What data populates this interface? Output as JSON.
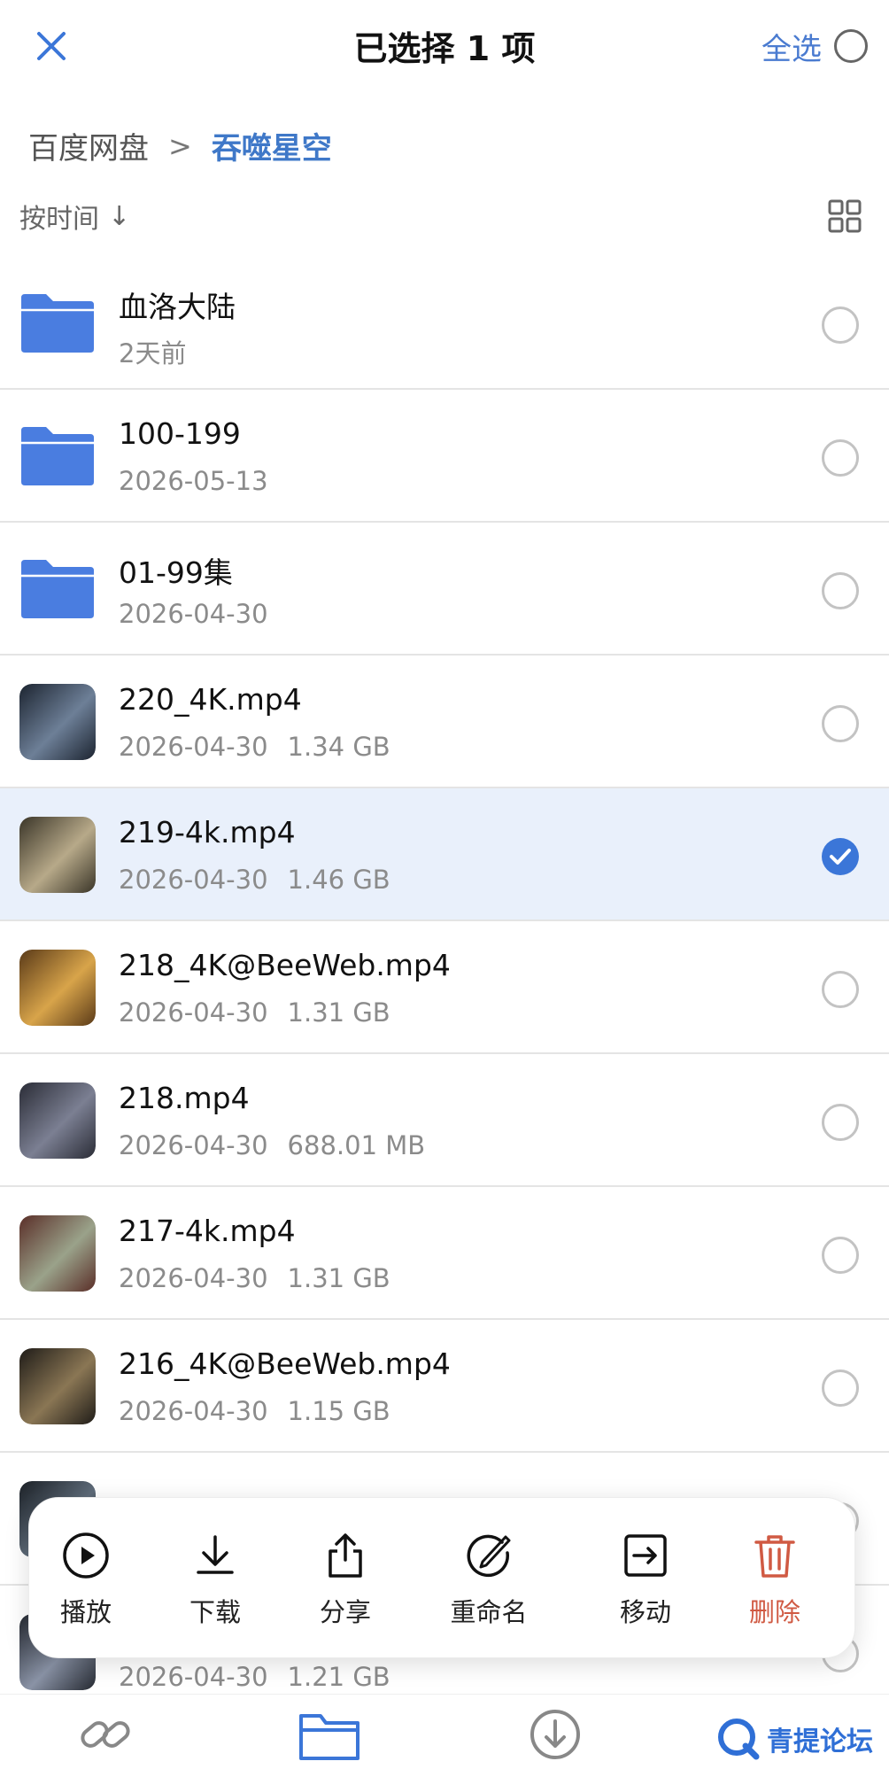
{
  "header": {
    "title": "已选择 1 项",
    "select_all_label": "全选"
  },
  "breadcrumb": {
    "root": "百度网盘",
    "separator": ">",
    "current": "吞噬星空"
  },
  "sort": {
    "label": "按时间",
    "direction": "↓"
  },
  "files": [
    {
      "type": "folder",
      "name": "血洛大陆",
      "date": "2天前",
      "size": "",
      "selected": false
    },
    {
      "type": "folder",
      "name": "100-199",
      "date": "2026-05-13",
      "size": "",
      "selected": false
    },
    {
      "type": "folder",
      "name": "01-99集",
      "date": "2026-04-30",
      "size": "",
      "selected": false
    },
    {
      "type": "video",
      "name": "220_4K.mp4",
      "date": "2026-04-30",
      "size": "1.34 GB",
      "selected": false
    },
    {
      "type": "video",
      "name": "219-4k.mp4",
      "date": "2026-04-30",
      "size": "1.46 GB",
      "selected": true
    },
    {
      "type": "video",
      "name": "218_4K@BeeWeb.mp4",
      "date": "2026-04-30",
      "size": "1.31 GB",
      "selected": false
    },
    {
      "type": "video",
      "name": "218.mp4",
      "date": "2026-04-30",
      "size": "688.01 MB",
      "selected": false
    },
    {
      "type": "video",
      "name": "217-4k.mp4",
      "date": "2026-04-30",
      "size": "1.31 GB",
      "selected": false
    },
    {
      "type": "video",
      "name": "216_4K@BeeWeb.mp4",
      "date": "2026-04-30",
      "size": "1.15 GB",
      "selected": false
    },
    {
      "type": "video",
      "name": "",
      "date": "",
      "size": "",
      "selected": false
    },
    {
      "type": "video",
      "name": "",
      "date": "2026-04-30",
      "size": "1.21 GB",
      "selected": false
    }
  ],
  "actions": {
    "play": "播放",
    "download": "下载",
    "share": "分享",
    "rename": "重命名",
    "move": "移动",
    "delete": "删除"
  },
  "watermark": {
    "text": "青提论坛"
  },
  "colors": {
    "accent": "#3b76d8",
    "folder": "#4a7de0",
    "selected_row": "#e9f0fb",
    "delete": "#d05a43"
  }
}
